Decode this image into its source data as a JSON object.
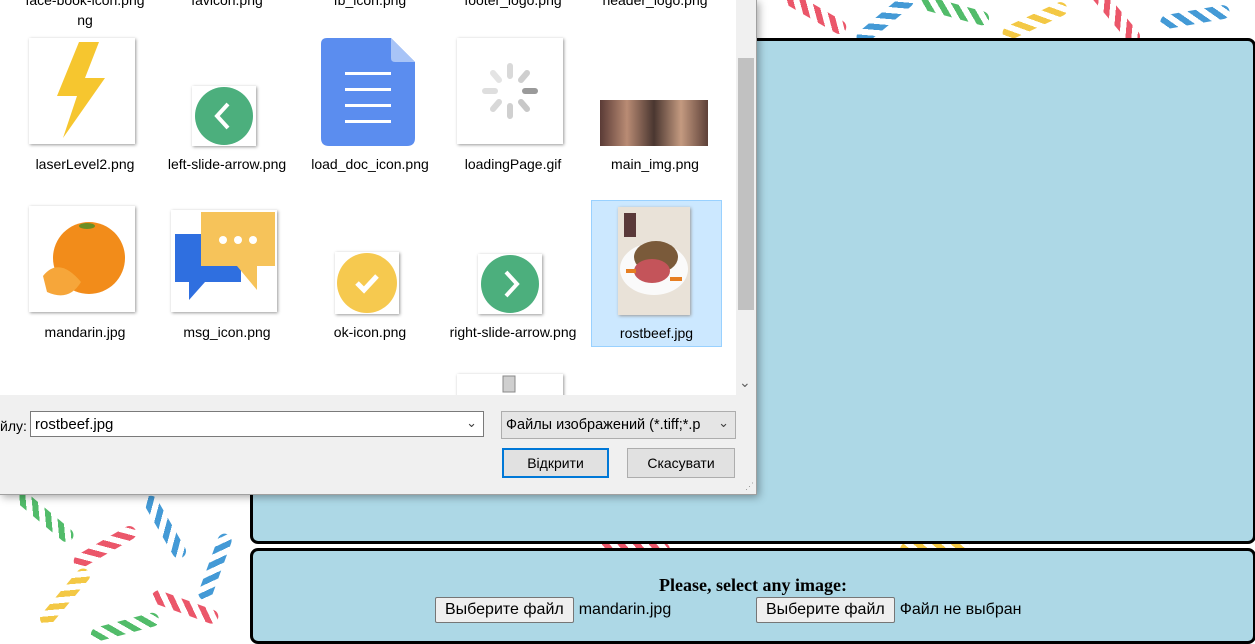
{
  "dialog": {
    "top_row_labels": [
      "face-book-icon.png",
      "favicon.png",
      "fb_icon.png",
      "footer_logo.png",
      "header_logo.png"
    ],
    "files": [
      {
        "label": "laserLevel2.png",
        "icon": "lightning-icon"
      },
      {
        "label": "left-slide-arrow.png",
        "icon": "left-arrow-icon"
      },
      {
        "label": "load_doc_icon.png",
        "icon": "document-icon"
      },
      {
        "label": "loadingPage.gif",
        "icon": "loading-spinner-icon"
      },
      {
        "label": "main_img.png",
        "icon": "photo-thumbnail"
      },
      {
        "label": "mandarin.jpg",
        "icon": "mandarin-thumbnail"
      },
      {
        "label": "msg_icon.png",
        "icon": "chat-bubbles-icon"
      },
      {
        "label": "ok-icon.png",
        "icon": "checkmark-icon"
      },
      {
        "label": "right-slide-arrow.png",
        "icon": "right-arrow-icon"
      },
      {
        "label": "rostbeef.jpg",
        "icon": "roast-beef-thumbnail",
        "selected": true
      }
    ],
    "filename_label": "йлу:",
    "filename_value": "rostbeef.jpg",
    "filter_value": "Файлы изображений (*.tiff;*.p",
    "open_button": "Відкрити",
    "cancel_button": "Скасувати"
  },
  "page": {
    "prompt": "Please, select any image:",
    "file_inputs": [
      {
        "button": "Выберите файл",
        "status": "mandarin.jpg"
      },
      {
        "button": "Выберите файл",
        "status": "Файл не выбран"
      }
    ]
  },
  "colors": {
    "panel_bg": "#add8e6",
    "selection_bg": "#cce8ff",
    "primary_border": "#0078d7"
  }
}
